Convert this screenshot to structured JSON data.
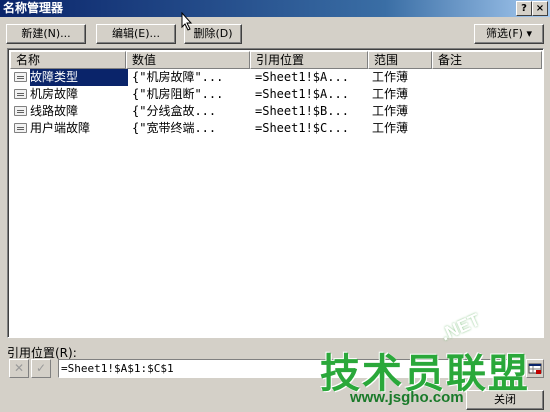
{
  "window": {
    "title": "名称管理器",
    "help_label": "?",
    "close_label": "×"
  },
  "toolbar": {
    "new_label": "新建(N)...",
    "edit_label": "编辑(E)...",
    "delete_label": "删除(D)",
    "filter_label": "筛选(F) ▾"
  },
  "table": {
    "columns": [
      "名称",
      "数值",
      "引用位置",
      "范围",
      "备注"
    ],
    "rows": [
      {
        "name": "故障类型",
        "value": "{\"机房故障\"...",
        "ref": "=Sheet1!$A...",
        "scope": "工作薄",
        "note": "",
        "selected": true
      },
      {
        "name": "机房故障",
        "value": "{\"机房阻断\"...",
        "ref": "=Sheet1!$A...",
        "scope": "工作薄",
        "note": "",
        "selected": false
      },
      {
        "name": "线路故障",
        "value": "{\"分线盒故...",
        "ref": "=Sheet1!$B...",
        "scope": "工作薄",
        "note": "",
        "selected": false
      },
      {
        "name": "用户端故障",
        "value": "{\"宽带终端...",
        "ref": "=Sheet1!$C...",
        "scope": "工作薄",
        "note": "",
        "selected": false
      }
    ]
  },
  "reference": {
    "label": "引用位置(R):",
    "value": "=Sheet1!$A$1:$C$1",
    "cancel_symbol": "✕",
    "confirm_symbol": "✓"
  },
  "footer": {
    "close_label": "关闭"
  },
  "watermark": {
    "brand": "技术员联盟",
    "url": "www.jsgho.com",
    "suffix": ".NET"
  }
}
